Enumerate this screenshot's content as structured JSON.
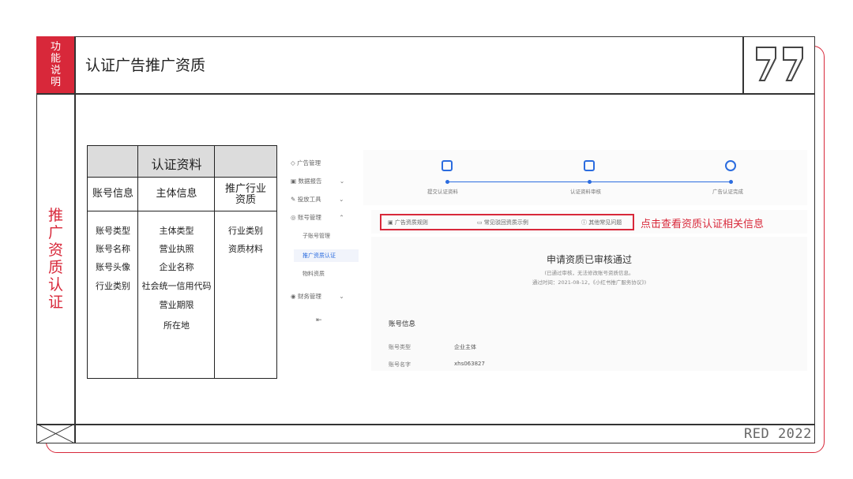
{
  "section": {
    "label": "功能说明",
    "title": "认证广告推广资质"
  },
  "side": {
    "label": "推广资质认证"
  },
  "footer": {
    "brand": "RED 2022"
  },
  "table": {
    "header": "认证资料",
    "columns": [
      "账号信息",
      "主体信息",
      "推广行业资质"
    ],
    "col1": [
      "账号类型",
      "账号名称",
      "账号头像",
      "行业类别"
    ],
    "col2": [
      "主体类型",
      "营业执照",
      "企业名称",
      "社会统一信用代码",
      "营业期限",
      "所在地"
    ],
    "col3": [
      "行业类别",
      "资质材料"
    ]
  },
  "nav": {
    "items": [
      "广告管理",
      "数据报告",
      "投放工具",
      "账号管理"
    ],
    "sub": [
      "子账号管理",
      "推广资质认证",
      "物料资质"
    ],
    "finance": "财务管理"
  },
  "steps": [
    "提交认证资料",
    "认证资料审核",
    "广告认证完成"
  ],
  "tabs": [
    "广告资质规则",
    "常见驳回资质示例",
    "其他常见问题"
  ],
  "note": "点击查看资质认证相关信息",
  "status": {
    "title": "申请资质已审核通过",
    "sub1": "(已通过审核，无法修改账号资质信息。",
    "sub2": "通过时间：2021-08-12，《小红书推广服务协议》)"
  },
  "account": {
    "title": "账号信息",
    "rows": [
      {
        "k": "账号类型",
        "v": "企业主体"
      },
      {
        "k": "账号名字",
        "v": "xhs063827"
      }
    ]
  },
  "colors": {
    "accent": "#d8283a",
    "link": "#2b6cdf"
  }
}
